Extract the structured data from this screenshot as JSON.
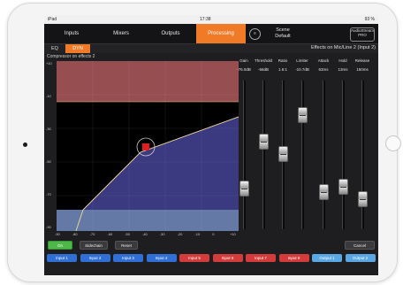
{
  "status": {
    "left": "iPad",
    "time": "17:38",
    "right": "93 %"
  },
  "tabs": [
    "Inputs",
    "Mixers",
    "Outputs",
    "Processing"
  ],
  "scene": {
    "icon": "scene-icon",
    "line1": "Scene",
    "line2": "Default"
  },
  "logo": {
    "line1": "AudioStream",
    "line2": "PRO"
  },
  "subtabs": [
    "EQ",
    "DYN"
  ],
  "effects_title": "Effects on Mic/Line 2 (Input 2)",
  "compressor_label": "Compressor on effects 2",
  "params": {
    "headers": [
      "Gain",
      "Threshold",
      "Ratio",
      "Limiter",
      "Attack",
      "Hold",
      "Release"
    ],
    "values": [
      "-76.0dB",
      "-56dB",
      "1.6:1",
      "-10.7dB",
      "63ms",
      "13ms",
      "150ms"
    ],
    "levels": [
      0.75,
      0.4,
      0.49,
      0.2,
      0.78,
      0.74,
      0.83
    ]
  },
  "graph_ticks": {
    "y": [
      "+10",
      "-10",
      "-30",
      "-50",
      "-70",
      "-90"
    ],
    "x": [
      "-90",
      "-80",
      "-70",
      "-60",
      "-50",
      "-40",
      "-30",
      "-20",
      "-10",
      "0",
      "+10"
    ]
  },
  "controls": {
    "on": "On",
    "sidechain": "Sidechain",
    "reset": "Reset",
    "cancel": "Cancel"
  },
  "io": [
    {
      "label": "Input 1",
      "color": "#2f6fd6"
    },
    {
      "label": "Input 2",
      "color": "#2f6fd6"
    },
    {
      "label": "Input 3",
      "color": "#2f6fd6"
    },
    {
      "label": "Input 4",
      "color": "#2f6fd6"
    },
    {
      "label": "Input 5",
      "color": "#d43c3c"
    },
    {
      "label": "Input 6",
      "color": "#d43c3c"
    },
    {
      "label": "Input 7",
      "color": "#d43c3c"
    },
    {
      "label": "Input 8",
      "color": "#d43c3c"
    },
    {
      "label": "Output 1",
      "color": "#5aa7e6"
    },
    {
      "label": "Output 2",
      "color": "#5aa7e6"
    }
  ]
}
